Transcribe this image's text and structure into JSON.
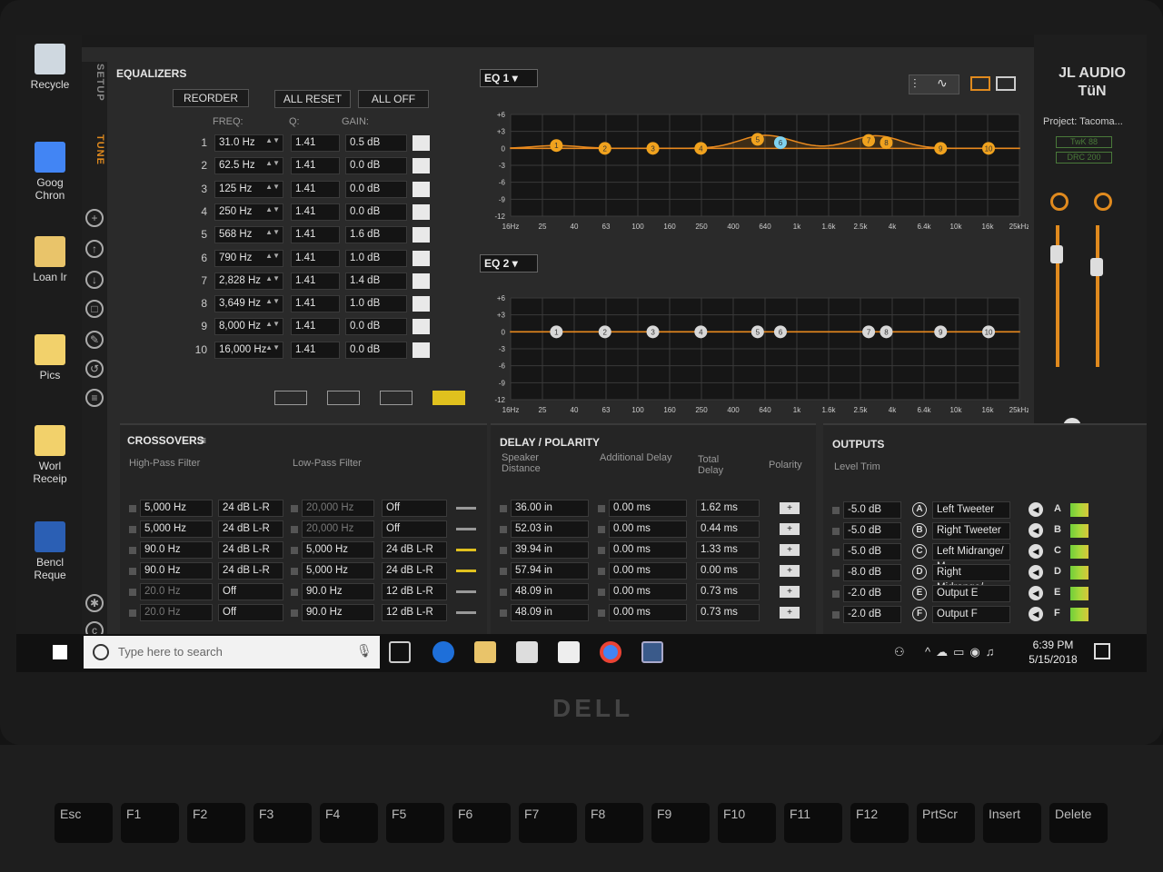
{
  "desktop": {
    "icons": [
      {
        "label": "Recycle",
        "color": "#cfd8e0"
      },
      {
        "label": "Goog Chron",
        "color": "#4285f4"
      },
      {
        "label": "Loan Ir",
        "color": "#e9c46a"
      },
      {
        "label": "Pics",
        "color": "#f2d16b"
      },
      {
        "label": "Worl Receip",
        "color": "#f2d16b"
      },
      {
        "label": "Bencl Reque",
        "color": "#2b5fb4"
      }
    ]
  },
  "app": {
    "side_tabs": {
      "setup": "SETUP",
      "tune": "TUNE"
    },
    "brand": {
      "logo_line1": "JL AUDIO",
      "logo_line2": "TüN",
      "project": "Project: Tacoma...",
      "device1": "TwK 88",
      "device2": "DRC 200"
    },
    "equalizers": {
      "title": "EQUALIZERS",
      "reorder": "REORDER",
      "all_reset": "ALL RESET",
      "all_off": "ALL OFF",
      "col_freq": "FREQ:",
      "col_q": "Q:",
      "col_gain": "GAIN:",
      "rows": [
        {
          "n": "1",
          "freq": "31.0 Hz",
          "q": "1.41",
          "gain": "0.5 dB"
        },
        {
          "n": "2",
          "freq": "62.5 Hz",
          "q": "1.41",
          "gain": "0.0 dB"
        },
        {
          "n": "3",
          "freq": "125 Hz",
          "q": "1.41",
          "gain": "0.0 dB"
        },
        {
          "n": "4",
          "freq": "250 Hz",
          "q": "1.41",
          "gain": "0.0 dB"
        },
        {
          "n": "5",
          "freq": "568 Hz",
          "q": "1.41",
          "gain": "1.6 dB"
        },
        {
          "n": "6",
          "freq": "790 Hz",
          "q": "1.41",
          "gain": "1.0 dB"
        },
        {
          "n": "7",
          "freq": "2,828 Hz",
          "q": "1.41",
          "gain": "1.4 dB"
        },
        {
          "n": "8",
          "freq": "3,649 Hz",
          "q": "1.41",
          "gain": "1.0 dB"
        },
        {
          "n": "9",
          "freq": "8,000 Hz",
          "q": "1.41",
          "gain": "0.0 dB"
        },
        {
          "n": "10",
          "freq": "16,000 Hz",
          "q": "1.41",
          "gain": "0.0 dB"
        }
      ]
    },
    "eq1": {
      "label": "EQ 1",
      "y_ticks": [
        "+6",
        "+3",
        "0",
        "-3",
        "-6",
        "-9",
        "-12"
      ],
      "x_ticks": [
        "16Hz",
        "25",
        "40",
        "63",
        "100",
        "160",
        "250",
        "400",
        "640",
        "1k",
        "1.6k",
        "2.5k",
        "4k",
        "6.4k",
        "10k",
        "16k",
        "25kHz"
      ],
      "accent": "#f0a21e",
      "selected_color": "#7fd3f0"
    },
    "eq2": {
      "label": "EQ 2",
      "y_ticks": [
        "+6",
        "+3",
        "0",
        "-3",
        "-6",
        "-9",
        "-12"
      ],
      "x_ticks": [
        "16Hz",
        "25",
        "40",
        "63",
        "100",
        "160",
        "250",
        "400",
        "640",
        "1k",
        "1.6k",
        "2.5k",
        "4k",
        "6.4k",
        "10k",
        "16k",
        "25kHz"
      ]
    },
    "crossovers": {
      "title": "CROSSOVERS",
      "hpf": "High-Pass Filter",
      "lpf": "Low-Pass Filter",
      "rows": [
        {
          "hp_freq": "5,000 Hz",
          "hp_slope": "24 dB L-R",
          "lp_freq": "20,000 Hz",
          "lp_slope": "Off"
        },
        {
          "hp_freq": "5,000 Hz",
          "hp_slope": "24 dB L-R",
          "lp_freq": "20,000 Hz",
          "lp_slope": "Off"
        },
        {
          "hp_freq": "90.0 Hz",
          "hp_slope": "24 dB L-R",
          "lp_freq": "5,000 Hz",
          "lp_slope": "24 dB L-R"
        },
        {
          "hp_freq": "90.0 Hz",
          "hp_slope": "24 dB L-R",
          "lp_freq": "5,000 Hz",
          "lp_slope": "24 dB L-R"
        },
        {
          "hp_freq": "20.0 Hz",
          "hp_slope": "Off",
          "lp_freq": "90.0 Hz",
          "lp_slope": "12 dB L-R"
        },
        {
          "hp_freq": "20.0 Hz",
          "hp_slope": "Off",
          "lp_freq": "90.0 Hz",
          "lp_slope": "12 dB L-R"
        }
      ]
    },
    "delay": {
      "title": "DELAY / POLARITY",
      "col_distance": "Speaker Distance",
      "col_additional": "Additional Delay",
      "col_total": "Total Delay",
      "col_polarity": "Polarity",
      "rows": [
        {
          "distance": "36.00 in",
          "additional": "0.00 ms",
          "total": "1.62 ms"
        },
        {
          "distance": "52.03 in",
          "additional": "0.00 ms",
          "total": "0.44 ms"
        },
        {
          "distance": "39.94 in",
          "additional": "0.00 ms",
          "total": "1.33 ms"
        },
        {
          "distance": "57.94 in",
          "additional": "0.00 ms",
          "total": "0.00 ms"
        },
        {
          "distance": "48.09 in",
          "additional": "0.00 ms",
          "total": "0.73 ms"
        },
        {
          "distance": "48.09 in",
          "additional": "0.00 ms",
          "total": "0.73 ms"
        }
      ]
    },
    "outputs": {
      "title": "OUTPUTS",
      "level_trim": "Level Trim",
      "rows": [
        {
          "trim": "-5.0 dB",
          "letter": "A",
          "name": "Left Tweeter"
        },
        {
          "trim": "-5.0 dB",
          "letter": "B",
          "name": "Right Tweeter"
        },
        {
          "trim": "-5.0 dB",
          "letter": "C",
          "name": "Left Midrange/ M"
        },
        {
          "trim": "-8.0 dB",
          "letter": "D",
          "name": "Right Midrange/"
        },
        {
          "trim": "-2.0 dB",
          "letter": "E",
          "name": "Output E"
        },
        {
          "trim": "-2.0 dB",
          "letter": "F",
          "name": "Output F"
        }
      ]
    }
  },
  "taskbar": {
    "search_placeholder": "Type here to search",
    "time": "6:39 PM",
    "date": "5/15/2018"
  },
  "keyboard": {
    "keys": [
      "Esc",
      "F1",
      "F2",
      "F3",
      "F4",
      "F5",
      "F6",
      "F7",
      "F8",
      "F9",
      "F10",
      "F11",
      "F12",
      "PrtScr",
      "Insert",
      "Delete"
    ],
    "brand": "DELL"
  }
}
